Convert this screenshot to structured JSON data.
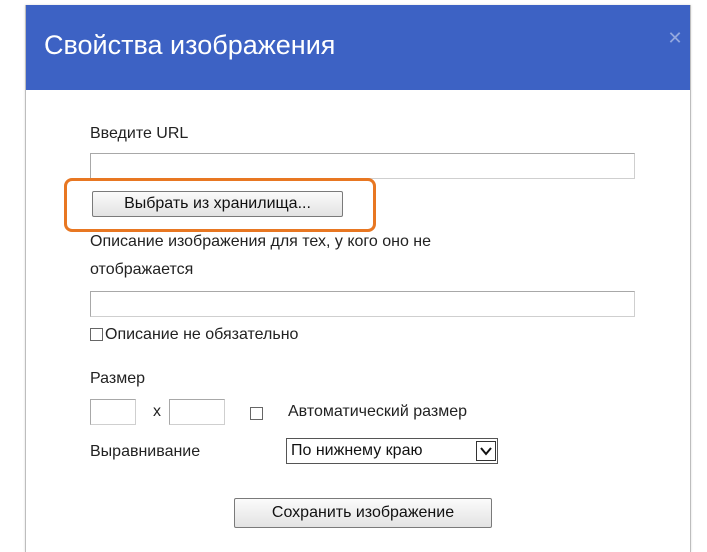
{
  "dialog": {
    "title": "Свойства изображения",
    "close_icon": "close-icon",
    "accent_color": "#3d62c4",
    "highlight_color": "#e87722"
  },
  "url_section": {
    "label": "Введите URL",
    "value": "",
    "placeholder": "",
    "choose_button": "Выбрать из хранилища..."
  },
  "description_section": {
    "label_line1": "Описание изображения для тех, у кого оно не",
    "label_line2": "отображается",
    "value": "",
    "placeholder": "",
    "optional_checkbox_label": "Описание не обязательно",
    "optional_checked": false
  },
  "size_section": {
    "label": "Размер",
    "width": "",
    "height": "",
    "separator": "x",
    "auto_size_label": "Автоматический размер",
    "auto_size_checked": false
  },
  "alignment_section": {
    "label": "Выравнивание",
    "selected": "По нижнему краю",
    "dropdown_icon": "chevron-down-icon"
  },
  "actions": {
    "save_button": "Сохранить изображение"
  }
}
